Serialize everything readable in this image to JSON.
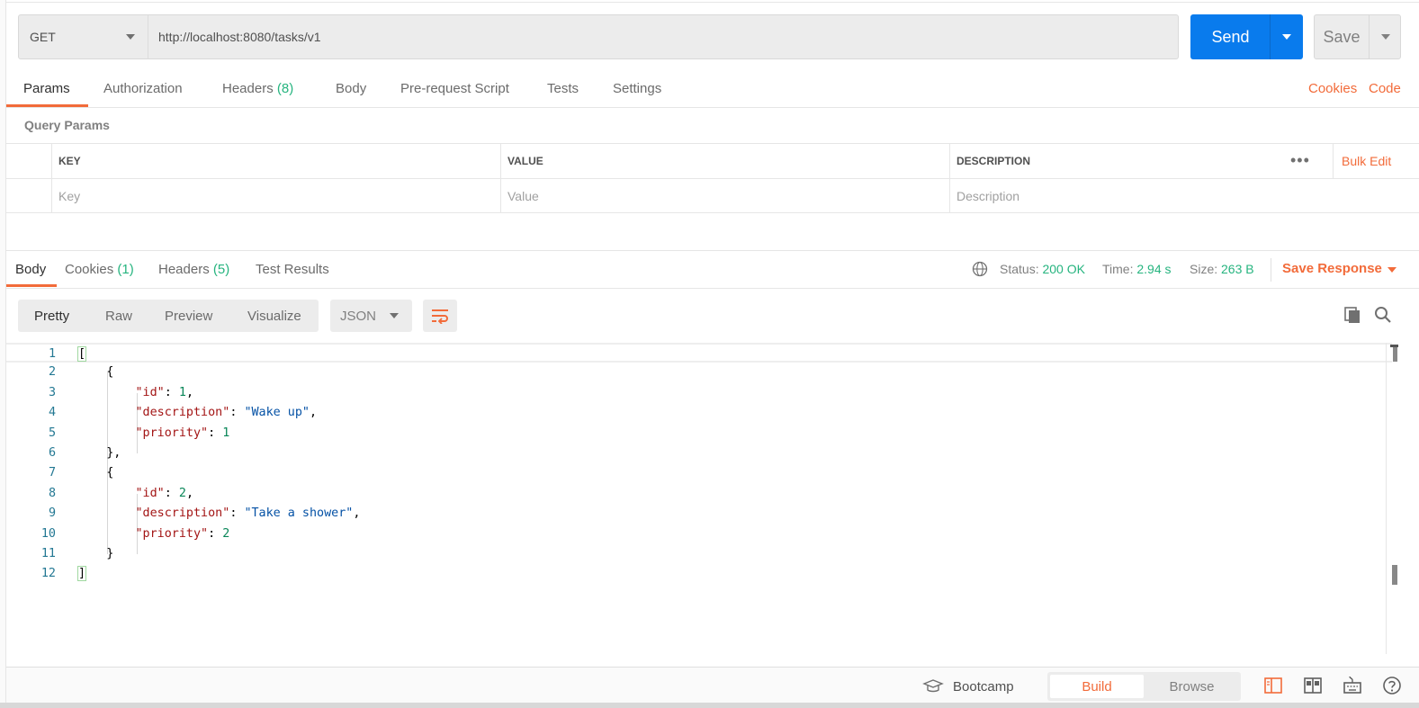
{
  "request": {
    "method": "GET",
    "url": "http://localhost:8080/tasks/v1",
    "send_label": "Send",
    "save_label": "Save"
  },
  "request_tabs": {
    "params": "Params",
    "authorization": "Authorization",
    "headers": "Headers",
    "headers_count": "(8)",
    "body": "Body",
    "prerequest": "Pre-request Script",
    "tests": "Tests",
    "settings": "Settings",
    "cookies": "Cookies",
    "code": "Code"
  },
  "query_params": {
    "title": "Query Params",
    "columns": {
      "key": "KEY",
      "value": "VALUE",
      "description": "DESCRIPTION"
    },
    "bulk_edit": "Bulk Edit",
    "more": "•••",
    "placeholders": {
      "key": "Key",
      "value": "Value",
      "description": "Description"
    }
  },
  "response_tabs": {
    "body": "Body",
    "cookies": "Cookies",
    "cookies_count": "(1)",
    "headers": "Headers",
    "headers_count": "(5)",
    "test_results": "Test Results"
  },
  "response_meta": {
    "status_label": "Status:",
    "status_value": "200 OK",
    "time_label": "Time:",
    "time_value": "2.94 s",
    "size_label": "Size:",
    "size_value": "263 B",
    "save_response": "Save Response"
  },
  "view_modes": {
    "pretty": "Pretty",
    "raw": "Raw",
    "preview": "Preview",
    "visualize": "Visualize",
    "format": "JSON"
  },
  "code_lines": [
    {
      "n": "1"
    },
    {
      "n": "2"
    },
    {
      "n": "3"
    },
    {
      "n": "4"
    },
    {
      "n": "5"
    },
    {
      "n": "6"
    },
    {
      "n": "7"
    },
    {
      "n": "8"
    },
    {
      "n": "9"
    },
    {
      "n": "10"
    },
    {
      "n": "11"
    },
    {
      "n": "12"
    }
  ],
  "json_tokens": {
    "open_array": "[",
    "close_array": "]",
    "open_obj": "{",
    "close_obj_comma": "},",
    "close_obj": "}",
    "key_id": "\"id\"",
    "key_description": "\"description\"",
    "key_priority": "\"priority\"",
    "colon": ": ",
    "comma": ",",
    "item1_id": "1",
    "item1_description": "\"Wake up\"",
    "item1_priority": "1",
    "item2_id": "2",
    "item2_description": "\"Take a shower\"",
    "item2_priority": "2"
  },
  "statusbar": {
    "bootcamp": "Bootcamp",
    "build": "Build",
    "browse": "Browse"
  },
  "colors": {
    "accent": "#f26b3a",
    "primary": "#097bed",
    "success": "#26b47f"
  }
}
